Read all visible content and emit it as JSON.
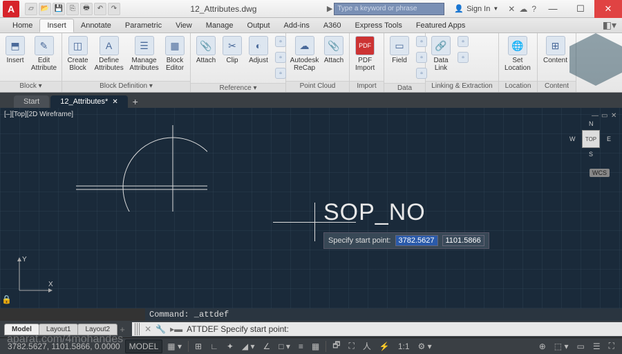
{
  "app_icon": "A",
  "title": "12_Attributes.dwg",
  "search_placeholder": "Type a keyword or phrase",
  "signin": "Sign In",
  "menutabs": [
    "Home",
    "Insert",
    "Annotate",
    "Parametric",
    "View",
    "Manage",
    "Output",
    "Add-ins",
    "A360",
    "Express Tools",
    "Featured Apps"
  ],
  "active_menutab": "Insert",
  "ribbon": {
    "panels": [
      {
        "label": "Block ▾",
        "items": [
          {
            "l": "Insert",
            "i": "⬒"
          },
          {
            "l": "Edit\nAttribute",
            "i": "✎"
          }
        ]
      },
      {
        "label": "Block Definition ▾",
        "items": [
          {
            "l": "Create\nBlock",
            "i": "◫"
          },
          {
            "l": "Define\nAttributes",
            "i": "A"
          },
          {
            "l": "Manage\nAttributes",
            "i": "☰"
          },
          {
            "l": "Block\nEditor",
            "i": "▦"
          }
        ]
      },
      {
        "label": "Reference ▾",
        "items": [
          {
            "l": "Attach",
            "i": "📎"
          },
          {
            "l": "Clip",
            "i": "✂"
          },
          {
            "l": "Adjust",
            "i": "◐"
          }
        ],
        "smallcol": true
      },
      {
        "label": "Point Cloud",
        "items": [
          {
            "l": "Autodesk\nReCap",
            "i": "☁"
          },
          {
            "l": "Attach",
            "i": "📎"
          }
        ]
      },
      {
        "label": "Import",
        "items": [
          {
            "l": "PDF\nImport",
            "i": "PDF"
          }
        ]
      },
      {
        "label": "Data",
        "items": [
          {
            "l": "Field",
            "i": "▭"
          }
        ],
        "smallcol": true
      },
      {
        "label": "Linking & Extraction",
        "items": [
          {
            "l": "Data\nLink",
            "i": "🔗"
          }
        ],
        "smallcol": true
      },
      {
        "label": "Location",
        "items": [
          {
            "l": "Set\nLocation",
            "i": "🌐"
          }
        ]
      },
      {
        "label": "Content",
        "items": [
          {
            "l": "Content",
            "i": "⊞"
          }
        ]
      }
    ]
  },
  "filetabs": [
    {
      "label": "Start",
      "active": false
    },
    {
      "label": "12_Attributes*",
      "active": true
    }
  ],
  "viewport": {
    "label": "[–][Top][2D Wireframe]",
    "cube_top": "TOP",
    "dir_n": "N",
    "dir_s": "S",
    "dir_e": "E",
    "dir_w": "W",
    "wcs": "WCS",
    "ucs_x": "X",
    "ucs_y": "Y",
    "drawing_text": "SOP_NO",
    "tooltip_label": "Specify start point:",
    "tooltip_x": "3782.5627",
    "tooltip_y": "1101.5866"
  },
  "cmd": {
    "history": "Command: _attdef",
    "line": "ATTDEF Specify start point:"
  },
  "layouts": [
    "Model",
    "Layout1",
    "Layout2"
  ],
  "statusbar": {
    "coords": "3782.5627, 1101.5866, 0.0000",
    "mode": "MODEL",
    "scale": "1:1"
  },
  "watermark": "aparat.com/4mohandes"
}
